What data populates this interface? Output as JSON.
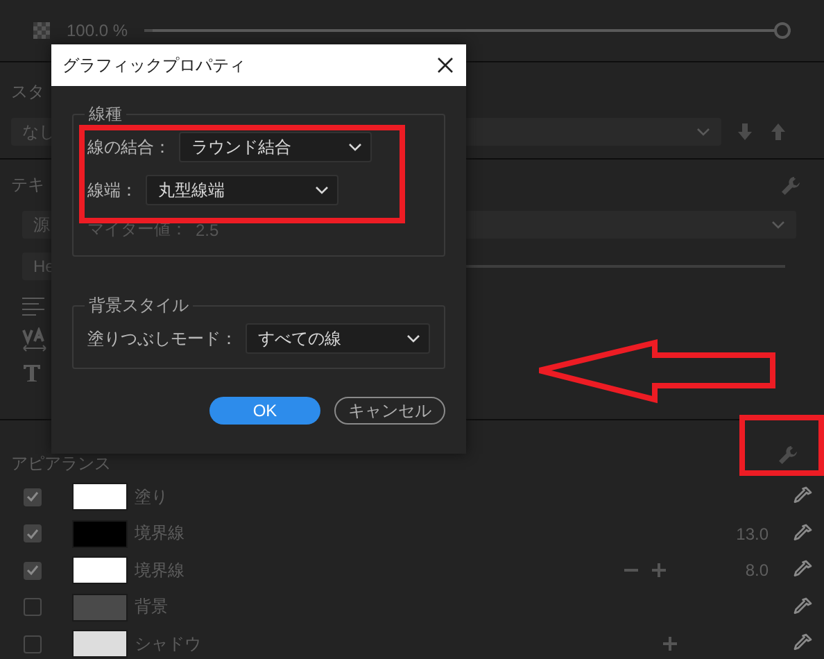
{
  "opacity": {
    "reading": "100.0 %",
    "level": 1
  },
  "style_section": {
    "label": "スタ",
    "dropdown": "なし"
  },
  "text_section": {
    "label": "テキ",
    "font_dropdown": "源",
    "font_style_field": "He"
  },
  "appearance": {
    "label": "アピアランス",
    "items": [
      {
        "checked": true,
        "color": "#ffffff",
        "label": "塗り",
        "show_minus": false,
        "show_plus": false
      },
      {
        "checked": true,
        "color": "#000000",
        "label": "境界線",
        "value": "13.0",
        "show_minus": false,
        "show_plus": false
      },
      {
        "checked": true,
        "color": "#ffffff",
        "label": "境界線",
        "value": "8.0",
        "show_minus": true,
        "show_plus": true
      },
      {
        "checked": false,
        "color": "#4a4a4a",
        "label": "背景",
        "show_minus": false,
        "show_plus": false
      },
      {
        "checked": false,
        "color": "#dddddd",
        "label": "シャドウ",
        "show_minus": false,
        "show_plus": true
      }
    ]
  },
  "dialog": {
    "title": "グラフィックプロパティ",
    "sections": [
      {
        "legend": "線種",
        "fields": [
          {
            "kind": "select",
            "label": "線の結合：",
            "value": "ラウンド結合",
            "disabled": false
          },
          {
            "kind": "select",
            "label": "線端：",
            "value": "丸型線端",
            "disabled": false
          },
          {
            "kind": "number",
            "label": "マイター値：",
            "value": "2.5",
            "disabled": true
          }
        ]
      },
      {
        "legend": "背景スタイル",
        "fields": [
          {
            "kind": "select",
            "label": "塗りつぶしモード：",
            "value": "すべての線",
            "disabled": false
          }
        ]
      }
    ],
    "buttons": [
      {
        "kind": "primary",
        "label": "OK"
      },
      {
        "kind": "secondary",
        "label": "キャンセル"
      }
    ]
  },
  "annotations": [
    {
      "kind": "box"
    },
    {
      "kind": "arrow"
    },
    {
      "kind": "box"
    }
  ]
}
